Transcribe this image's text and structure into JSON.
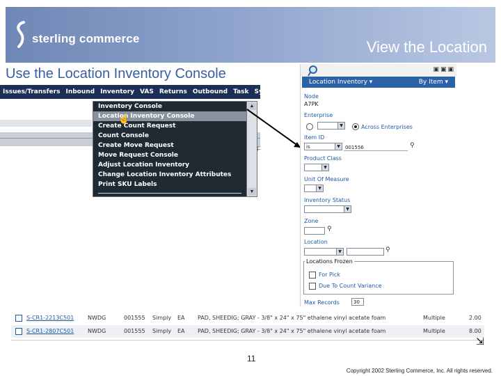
{
  "banner": {
    "logo_text": "sterling commerce",
    "slide_title": "View the Location"
  },
  "subtitle": "Use the Location Inventory Console",
  "menubar": {
    "items": [
      "Issues/Transfers",
      "Inbound",
      "Inventory",
      "VAS",
      "Returns",
      "Outbound",
      "Task",
      "System"
    ]
  },
  "dropdown": {
    "items": [
      "Inventory Console",
      "Location Inventory Console",
      "Create Count Request",
      "Count Console",
      "Create Move Request",
      "Move Request Console",
      "Adjust Location Inventory",
      "Change Location Inventory Attributes",
      "Print SKU Labels"
    ],
    "selected_index": 1
  },
  "panel": {
    "header_left": "Location Inventory",
    "header_right": "By Item",
    "node_label": "Node",
    "node_value": "A7PK",
    "enterprise_label": "Enterprise",
    "across_enterprises": "Across Enterprises",
    "item_id_label": "Item ID",
    "item_id_operator": "is",
    "item_id_value": "001556",
    "product_class_label": "Product Class",
    "uom_label": "Unit Of Measure",
    "inventory_status_label": "Inventory Status",
    "zone_label": "Zone",
    "location_label": "Location",
    "locations_frozen_label": "Locations Frozen",
    "for_pick_label": "For Pick",
    "due_to_count_label": "Due To Count Variance",
    "max_records_label": "Max Records",
    "max_records_value": "30"
  },
  "results": {
    "rows": [
      {
        "location": "S-CR1-2213C501",
        "node": "NWDG",
        "item": "001555",
        "pc": "Simply",
        "uom": "EA",
        "desc": "PAD, SHEEDIG; GRAY - 3/8\" x 24\" x 75\" ethalene vinyl acetate foam",
        "status": "Multiple",
        "qty": "2.00"
      },
      {
        "location": "S-CR1-2807C501",
        "node": "NWDG",
        "item": "001555",
        "pc": "Simply",
        "uom": "EA",
        "desc": "PAD, SHEEDIG; GRAY - 3/8\" x 24\" x 75\" ethalene vinyl acetate foam",
        "status": "Multiple",
        "qty": "8.00"
      }
    ]
  },
  "page_number": "11",
  "copyright": "Copyright 2002 Sterling Commerce, Inc. All rights reserved.",
  "colors": {
    "banner_start": "#6f87b6",
    "banner_end": "#b9c7e2",
    "subtitle": "#3a5f9e",
    "menubar": "#1d2f57",
    "panel_header": "#2b62a8",
    "link": "#1d5aa5"
  }
}
